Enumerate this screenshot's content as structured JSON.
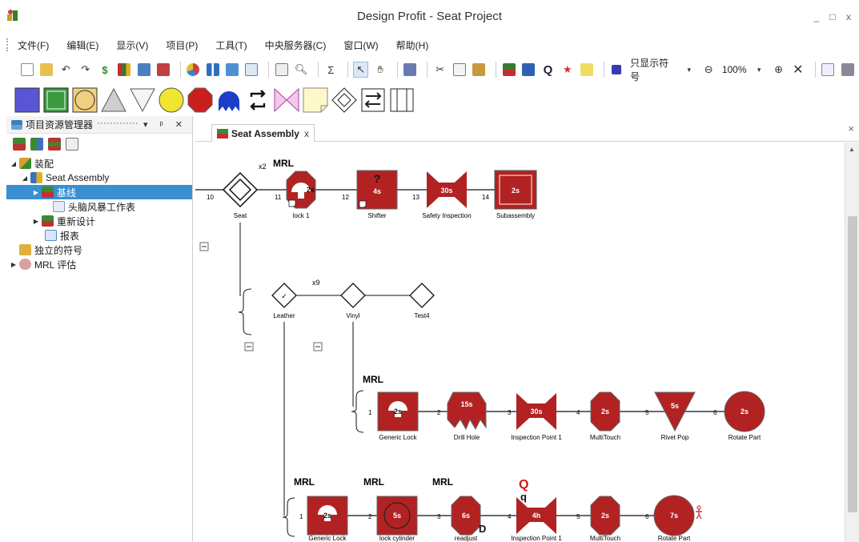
{
  "window": {
    "title": "Design Profit - Seat Project",
    "controls": [
      "_",
      "□",
      "x"
    ]
  },
  "menu": [
    "文件(F)",
    "编辑(E)",
    "显示(V)",
    "项目(P)",
    "工具(T)",
    "中央服务器(C)",
    "窗口(W)",
    "帮助(H)"
  ],
  "toolbar": {
    "symbol_filter": "只显示符号",
    "zoom": "100%",
    "sigma": "Σ"
  },
  "left_panel": {
    "title": "项目资源管理器",
    "pin": "▾ ᵖ ✕",
    "tree": [
      {
        "label": "装配",
        "indent": 0,
        "expanded": true
      },
      {
        "label": "Seat Assembly",
        "indent": 1,
        "expanded": true
      },
      {
        "label": "基线",
        "indent": 2,
        "expanded": false,
        "selected": true
      },
      {
        "label": "头脑风暴工作表",
        "indent": 3
      },
      {
        "label": "重新设计",
        "indent": 2,
        "expanded": false
      },
      {
        "label": "报表",
        "indent": 3
      },
      {
        "label": "独立的符号",
        "indent": 0
      },
      {
        "label": "MRL 评估",
        "indent": 0,
        "expanded": false
      }
    ]
  },
  "document": {
    "tab_label": "Seat Assembly",
    "tab_close": "x",
    "close": "×"
  },
  "diagram": {
    "main_row": {
      "labels": [
        "Seat",
        "lock 1",
        "Shifter",
        "Safety Inspection",
        "Subassembly"
      ],
      "steps": [
        "10",
        "11",
        "12",
        "13",
        "14"
      ],
      "times": [
        "2s",
        "4s",
        "30s",
        "2s"
      ],
      "mrl": "MRL",
      "x2": "x2",
      "question": "?"
    },
    "branch_row": {
      "labels": [
        "Leather",
        "Vinyl",
        "Test4"
      ],
      "x9": "x9"
    },
    "vinyl_row": {
      "mrl": "MRL",
      "labels": [
        "Generic Lock",
        "Drill Hole",
        "Inspection Point 1",
        "MultiTouch",
        "Rivet Pop",
        "Rotate Part"
      ],
      "steps": [
        "1",
        "2",
        "3",
        "4",
        "5",
        "6"
      ],
      "times": [
        "2s",
        "15s",
        "30s",
        "2s",
        "5s",
        "2s"
      ]
    },
    "leather_row": {
      "mrl": [
        "MRL",
        "MRL",
        "MRL"
      ],
      "labels": [
        "Generic Lock",
        "lock cylinder",
        "readjust",
        "Inspection Point 1",
        "MultiTouch",
        "Rotate Part"
      ],
      "steps": [
        "1",
        "2",
        "3",
        "4",
        "5",
        "6"
      ],
      "times": [
        "2s",
        "5s",
        "6s",
        "4h",
        "2s",
        "7s"
      ],
      "d_mark": "D",
      "q_big": "Q",
      "q_small": "q"
    },
    "collapse": "−"
  },
  "colors": {
    "red": "#b22222",
    "selection": "#3a8fd1"
  }
}
